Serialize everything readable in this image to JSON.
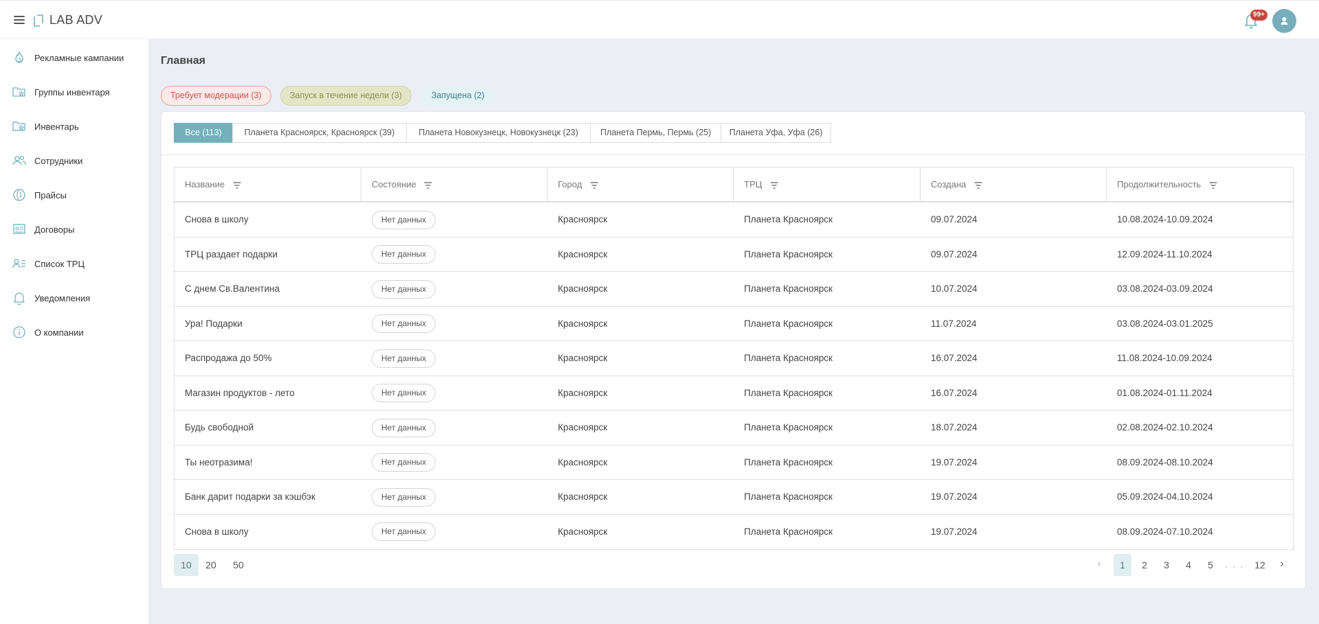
{
  "header": {
    "logo_text": "LAB ADV",
    "notification_badge": "99+"
  },
  "sidebar": {
    "items": [
      {
        "label": "Рекламные кампании",
        "icon": "fire-icon"
      },
      {
        "label": "Группы инвентаря",
        "icon": "folder-star-icon"
      },
      {
        "label": "Инвентарь",
        "icon": "folder-star-icon"
      },
      {
        "label": "Сотрудники",
        "icon": "users-icon"
      },
      {
        "label": "Прайсы",
        "icon": "price-icon"
      },
      {
        "label": "Договоры",
        "icon": "contract-icon"
      },
      {
        "label": "Список ТРЦ",
        "icon": "user-list-icon"
      },
      {
        "label": "Уведомления",
        "icon": "bell-icon"
      },
      {
        "label": "О компании",
        "icon": "info-icon"
      }
    ]
  },
  "main": {
    "title": "Главная",
    "status_chips": [
      {
        "label": "Требует модерации (3)"
      },
      {
        "label": "Запуск в течение недели (3)"
      },
      {
        "label": "Запущена (2)"
      }
    ],
    "tabs": [
      {
        "label": "Все (113)"
      },
      {
        "label": "Планета Красноярск, Красноярск (39)"
      },
      {
        "label": "Планета Новокузнецк, Новокузнецк (23)"
      },
      {
        "label": "Планета Пермь, Пермь (25)"
      },
      {
        "label": "Планета Уфа, Уфа (26)"
      }
    ],
    "table": {
      "columns": [
        "Название",
        "Состояние",
        "Город",
        "ТРЦ",
        "Создана",
        "Продолжительность"
      ],
      "rows": [
        {
          "name": "Снова в школу",
          "status": "Нет данных",
          "city": "Красноярск",
          "mall": "Планета Красноярск",
          "created": "09.07.2024",
          "duration": "10.08.2024-10.09.2024"
        },
        {
          "name": "ТРЦ раздает подарки",
          "status": "Нет данных",
          "city": "Красноярск",
          "mall": "Планета Красноярск",
          "created": "09.07.2024",
          "duration": "12.09.2024-11.10.2024"
        },
        {
          "name": "С днем Св.Валентина",
          "status": "Нет данных",
          "city": "Красноярск",
          "mall": "Планета Красноярск",
          "created": "10.07.2024",
          "duration": "03.08.2024-03.09.2024"
        },
        {
          "name": "Ура! Подарки",
          "status": "Нет данных",
          "city": "Красноярск",
          "mall": "Планета Красноярск",
          "created": "11.07.2024",
          "duration": "03.08.2024-03.01.2025"
        },
        {
          "name": "Распродажа до 50%",
          "status": "Нет данных",
          "city": "Красноярск",
          "mall": "Планета Красноярск",
          "created": "16.07.2024",
          "duration": "11.08.2024-10.09.2024"
        },
        {
          "name": "Магазин продуктов - лето",
          "status": "Нет данных",
          "city": "Красноярск",
          "mall": "Планета Красноярск",
          "created": "16.07.2024",
          "duration": "01.08.2024-01.11.2024"
        },
        {
          "name": "Будь свободной",
          "status": "Нет данных",
          "city": "Красноярск",
          "mall": "Планета Красноярск",
          "created": "18.07.2024",
          "duration": "02.08.2024-02.10.2024"
        },
        {
          "name": "Ты неотразима!",
          "status": "Нет данных",
          "city": "Красноярск",
          "mall": "Планета Красноярск",
          "created": "19.07.2024",
          "duration": "08.09.2024-08.10.2024"
        },
        {
          "name": "Банк дарит подарки за кэшбэк",
          "status": "Нет данных",
          "city": "Красноярск",
          "mall": "Планета Красноярск",
          "created": "19.07.2024",
          "duration": "05.09.2024-04.10.2024"
        },
        {
          "name": "Снова в школу",
          "status": "Нет данных",
          "city": "Красноярск",
          "mall": "Планета Красноярск",
          "created": "19.07.2024",
          "duration": "08.09.2024-07.10.2024"
        }
      ]
    },
    "page_sizes": [
      "10",
      "20",
      "50"
    ],
    "selected_page_size": "10",
    "pagination": {
      "pages_before": [
        "1",
        "2",
        "3",
        "4",
        "5"
      ],
      "ellipsis": ". . .",
      "last_page": "12",
      "current_page": "1"
    }
  }
}
